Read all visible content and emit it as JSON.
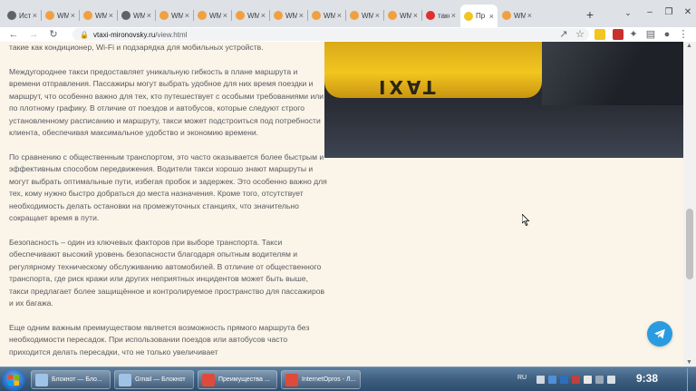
{
  "browser": {
    "tabs": [
      {
        "label": "Истор",
        "favicon_color": "#5f6368"
      },
      {
        "label": "WMm",
        "favicon_color": "#f0a040"
      },
      {
        "label": "WMm",
        "favicon_color": "#f0a040"
      },
      {
        "label": "WMm",
        "favicon_color": "#5f6368"
      },
      {
        "label": "WMm",
        "favicon_color": "#f0a040"
      },
      {
        "label": "WMm",
        "favicon_color": "#f0a040"
      },
      {
        "label": "WMm",
        "favicon_color": "#f0a040"
      },
      {
        "label": "WMm",
        "favicon_color": "#f0a040"
      },
      {
        "label": "WMm",
        "favicon_color": "#f0a040"
      },
      {
        "label": "WMm",
        "favicon_color": "#f0a040"
      },
      {
        "label": "WMm",
        "favicon_color": "#f0a040"
      },
      {
        "label": "такси",
        "favicon_color": "#e02f2f"
      },
      {
        "label": "Пр",
        "favicon_color": "#f2c51f"
      },
      {
        "label": "WMm",
        "favicon_color": "#f0a040"
      }
    ],
    "active_tab_index": 12,
    "url_host": "vtaxi-mironovsky.ru",
    "url_path": "/view.html"
  },
  "article": {
    "paragraphs": [
      "такие как кондиционер, Wi-Fi и подзарядка для мобильных устройств.",
      "Междугороднее такси предоставляет уникальную гибкость в плане маршрута и времени отправления. Пассажиры могут выбрать удобное для них время поездки и маршрут, что особенно важно для тех, кто путешествует с особыми требованиями или по плотному графику. В отличие от поездов и автобусов, которые следуют строго установленному расписанию и маршруту, такси может подстроиться под потребности клиента, обеспечивая максимальное удобство и экономию времени.",
      "По сравнению с общественным транспортом, это часто оказывается более быстрым и эффективным способом передвижения. Водители такси хорошо знают маршруты и могут выбрать оптимальные пути, избегая пробок и задержек. Это особенно важно для тех, кому нужно быстро добраться до места назначения. Кроме того, отсутствует необходимость делать остановки на промежуточных станциях, что значительно сокращает время в пути.",
      "Безопасность – один из ключевых факторов при выборе транспорта. Такси обеспечивают высокий уровень безопасности благодаря опытным водителям и регулярному техническому обслуживанию автомобилей. В отличие от общественного транспорта, где риск кражи или других неприятных инцидентов может быть выше, такси предлагает более защищённое и контролируемое пространство для пассажиров и их багажа.",
      "Еще одним важным преимуществом является возможность прямого маршрута без необходимости пересадок. При использовании поездов или автобусов часто приходится делать пересадки, что не только увеличивает"
    ],
    "hero_sign_text": "TAXI"
  },
  "taskbar": {
    "tasks": [
      {
        "label": "Блокнот — Бло...",
        "icon_color": "#9fc3e6"
      },
      {
        "label": "Gmail — Блокнот",
        "icon_color": "#9fc3e6"
      },
      {
        "label": "Преимущества ...",
        "icon_color": "#e04a3a"
      },
      {
        "label": "InternetOpros - Л...",
        "icon_color": "#e04a3a"
      }
    ],
    "lang": "RU",
    "time": "9:38"
  }
}
